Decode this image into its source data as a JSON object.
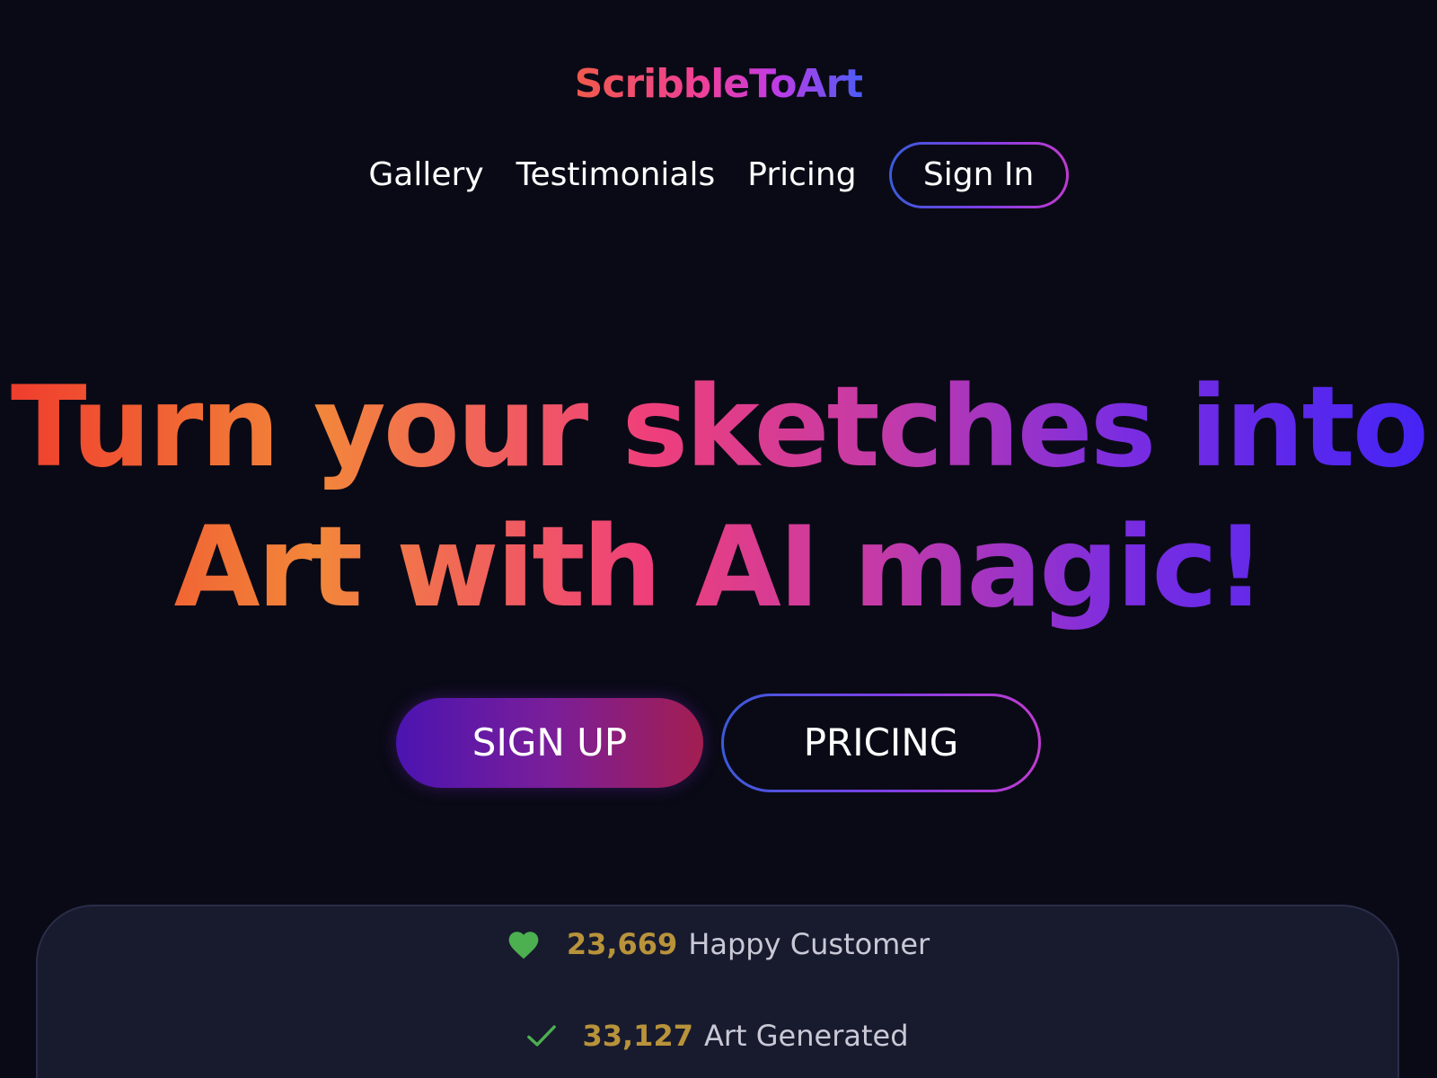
{
  "header": {
    "logo": "ScribbleToArt"
  },
  "nav": {
    "items": [
      {
        "label": "Gallery"
      },
      {
        "label": "Testimonials"
      },
      {
        "label": "Pricing"
      }
    ],
    "signin_label": "Sign In"
  },
  "hero": {
    "headline_line1": "Turn your sketches into",
    "headline_line2": "Art with AI magic!",
    "signup_label": "SIGN UP",
    "pricing_label": "PRICING"
  },
  "stats": [
    {
      "icon": "heart-icon",
      "number": "23,669",
      "label": "Happy Customer",
      "icon_color": "#4caf50"
    },
    {
      "icon": "check-icon",
      "number": "33,127",
      "label": "Art Generated",
      "icon_color": "#4caf50"
    }
  ],
  "colors": {
    "background": "#0a0a16",
    "stats_panel": "#181a2e",
    "stat_number": "#b8933a",
    "signup_gradient_start": "#4b14b0",
    "signup_gradient_end": "#a31e50"
  }
}
